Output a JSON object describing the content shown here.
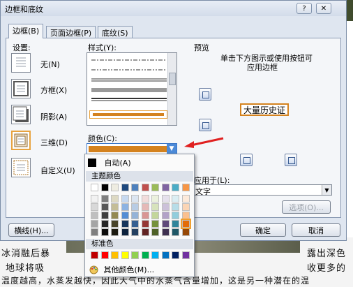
{
  "dialog": {
    "title": "边框和底纹",
    "help_label": "?",
    "close_label": "✕",
    "tabs": [
      {
        "label": "边框(B)"
      },
      {
        "label": "页面边框(P)"
      },
      {
        "label": "底纹(S)"
      }
    ],
    "settings_label": "设置:",
    "settings": [
      {
        "label": "无(N)"
      },
      {
        "label": "方框(X)"
      },
      {
        "label": "阴影(A)"
      },
      {
        "label": "三维(D)"
      },
      {
        "label": "自定义(U)"
      }
    ],
    "style_label": "样式(Y):",
    "color_label": "颜色(C):",
    "color_value": "#d4821e",
    "preview_label": "预览",
    "preview_hint_line1": "单击下方图示或使用按钮可",
    "preview_hint_line2": "应用边框",
    "preview_sample_text": "大量历史证",
    "apply_to_label": "应用于(L):",
    "apply_to_value": "文字",
    "options_button": "选项(O)...",
    "hline_button": "横线(H)...",
    "ok_button": "确定",
    "cancel_button": "取消"
  },
  "palette": {
    "auto_label": "自动(A)",
    "theme_header": "主题颜色",
    "theme_colors": [
      "#ffffff",
      "#000000",
      "#eeece1",
      "#1f497d",
      "#4f81bd",
      "#c0504d",
      "#9bbb59",
      "#8064a2",
      "#4bacc6",
      "#f79646"
    ],
    "theme_shades": [
      [
        "#f2f2f2",
        "#7f7f7f",
        "#ddd9c3",
        "#c6d9f0",
        "#dbe5f1",
        "#f2dcdb",
        "#ebf1dd",
        "#e5e0ec",
        "#dbeef3",
        "#fdeada"
      ],
      [
        "#d8d8d8",
        "#595959",
        "#c4bd97",
        "#8db3e2",
        "#b8cce4",
        "#e5b9b7",
        "#d7e3bc",
        "#ccc1d9",
        "#b7dde8",
        "#fbd5b5"
      ],
      [
        "#bfbfbf",
        "#3f3f3f",
        "#938953",
        "#548dd4",
        "#95b3d7",
        "#d99694",
        "#c3d69b",
        "#b2a2c7",
        "#92cddc",
        "#fac08f"
      ],
      [
        "#a5a5a5",
        "#262626",
        "#494429",
        "#17365d",
        "#366092",
        "#953734",
        "#76923c",
        "#5f497a",
        "#31859b",
        "#e36c09"
      ],
      [
        "#7f7f7f",
        "#0c0c0c",
        "#1d1b10",
        "#0f243e",
        "#244061",
        "#632423",
        "#4f6128",
        "#3f3151",
        "#205867",
        "#974806"
      ]
    ],
    "standard_header": "标准色",
    "standard_colors": [
      "#c00000",
      "#ff0000",
      "#ffc000",
      "#ffff00",
      "#92d050",
      "#00b050",
      "#00b0f0",
      "#0070c0",
      "#002060",
      "#7030a0"
    ],
    "more_colors_label": "其他颜色(M)..."
  },
  "background": {
    "line1_left": "冰消融后暴",
    "line1_right": "露出深色",
    "line2_left": "地球将吸",
    "line2_right": "收更多的",
    "line3": "温度越高，水蒸发越快，因此大气中的水蒸气含量增加，这是另一种潜在的温"
  }
}
